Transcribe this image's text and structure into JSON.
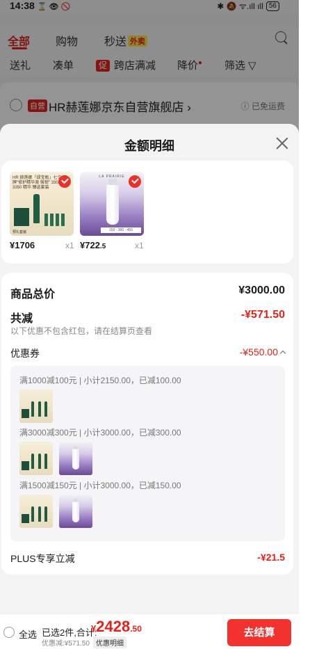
{
  "status_bar": {
    "time": "14:38",
    "time_icons": "⌛ 👁 🚫",
    "right_icons": "✱ 🔕 ᯤ.ıll ıll",
    "battery": "56"
  },
  "top_tabs": [
    {
      "label": "全部"
    },
    {
      "label": "购物"
    },
    {
      "label": "秒送"
    }
  ],
  "waimai_badge": "外卖",
  "filters": [
    {
      "label": "送礼"
    },
    {
      "label": "凑单"
    },
    {
      "label": "跨店满减",
      "icon_text": "促"
    },
    {
      "label": "降价"
    },
    {
      "label": "筛选 ▽"
    }
  ],
  "store": {
    "badge": "自营",
    "name": "HR赫莲娜京东自营旗舰店 ›",
    "shipping": "ⓘ 已免运费"
  },
  "sheet": {
    "title": "金额明细"
  },
  "products": [
    {
      "price_int": "¥1706",
      "price_dec": "",
      "qty": "x1",
      "thumb_label": "HR 赫莲娜「绿宝瓶」七夕 王牌\"修护精华液 强韧\" 330ml 3350 精华 臻选套装",
      "thumb_footer": "预礼套装"
    },
    {
      "price_int": "¥722",
      "price_dec": ".5",
      "qty": "x1",
      "thumb_brand": "LA PRAIRIE",
      "thumb_sizes": "150 · 300 · 450"
    }
  ],
  "summary": {
    "total_label": "商品总价",
    "total_value": "¥3000.00",
    "reduce_label": "共减",
    "reduce_value": "-¥571.50",
    "reduce_note": "以下优惠不包含红包，请在结算页查看",
    "coupon_label": "优惠券",
    "coupon_value": "-¥550.00",
    "coupon_rules": [
      {
        "text": "满1000减100元 | 小计2150.00，已减100.00"
      },
      {
        "text": "满3000减300元 | 小计3000.00，已减300.00"
      },
      {
        "text": "满1500减150元 | 小计3000.00，已减150.00"
      }
    ],
    "plus_label": "PLUS专享立减",
    "plus_value": "-¥21.5"
  },
  "bottom_bar": {
    "select_all": "全选",
    "selected_text": "已选2件,合计:",
    "total_currency": "¥",
    "total_int": "2428",
    "total_dec": ".50",
    "discount_text": "优惠减:¥571.50",
    "detail_tag": "优惠明细",
    "checkout_label": "去结算"
  },
  "colors": {
    "accent_red": "#e2231a",
    "checkout_button": "#f2322f",
    "sheet_background": "#f3f3f3"
  }
}
